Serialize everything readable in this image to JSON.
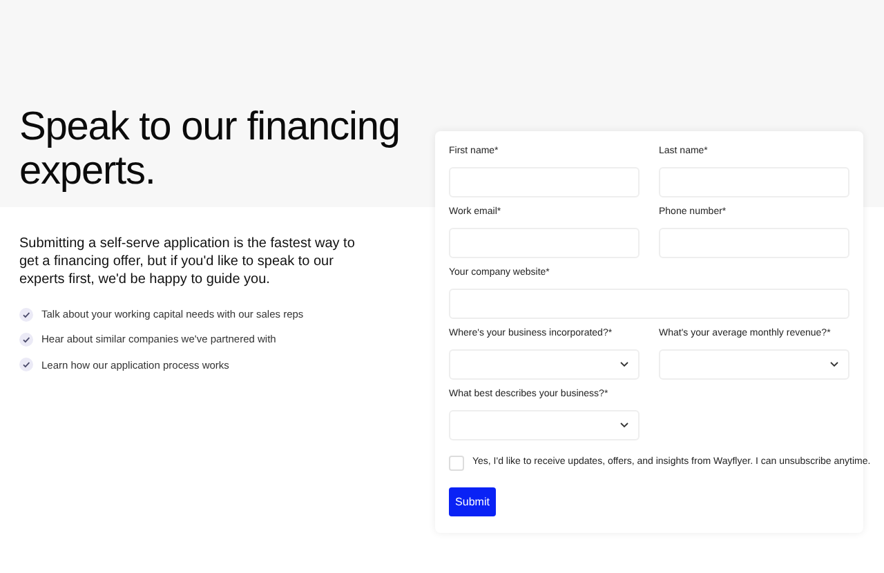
{
  "heading": "Speak to our financing experts.",
  "intro": "Submitting a self-serve application is the fastest way to get a financing offer, but if you'd like to speak to our experts first, we'd be happy to guide you.",
  "benefits": [
    "Talk about your working capital needs with our sales reps",
    "Hear about similar companies we've partnered with",
    "Learn how our application process works"
  ],
  "form": {
    "rows": [
      [
        {
          "kind": "text",
          "label": "First name*"
        },
        {
          "kind": "text",
          "label": "Last name*"
        }
      ],
      [
        {
          "kind": "text",
          "label": "Work email*"
        },
        {
          "kind": "text",
          "label": "Phone number*"
        }
      ],
      [
        {
          "kind": "text",
          "label": "Your company website*"
        }
      ],
      [
        {
          "kind": "select",
          "label": "Where's your business incorporated?*"
        },
        {
          "kind": "select",
          "label": "What's your average monthly revenue?*"
        }
      ],
      [
        {
          "kind": "select",
          "label": "What best describes your business?*"
        }
      ]
    ],
    "consent": {
      "label": "Yes, I'd like to receive updates, offers, and insights from Wayflyer. I can unsubscribe anytime.",
      "checked": false
    },
    "submit": "Submit"
  }
}
